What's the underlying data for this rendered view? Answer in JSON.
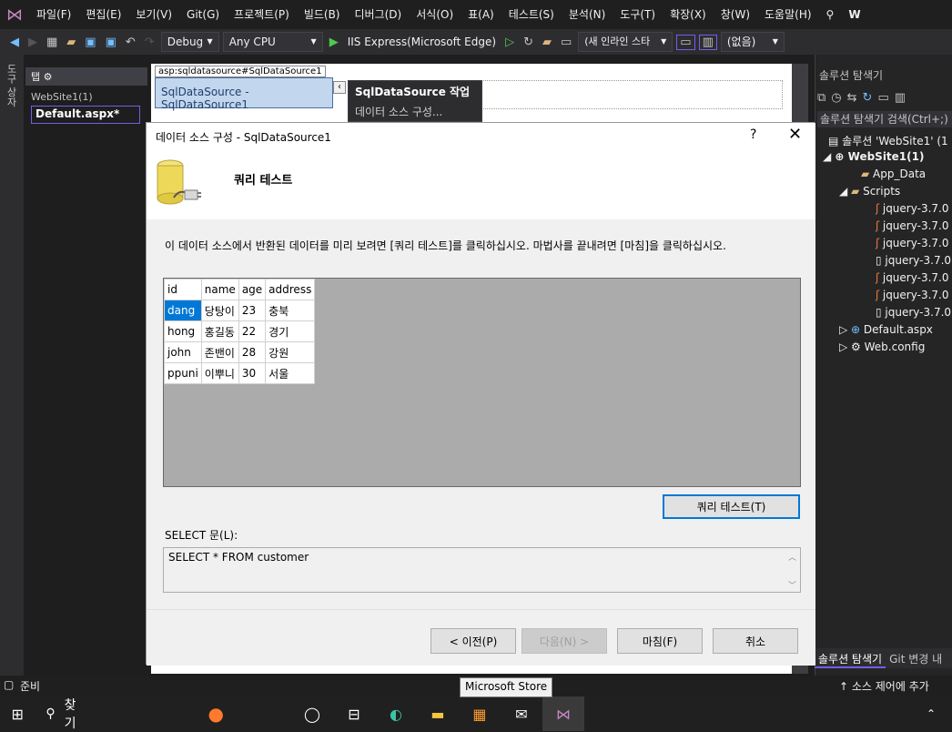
{
  "menubar": {
    "items": [
      "파일(F)",
      "편집(E)",
      "보기(V)",
      "Git(G)",
      "프로젝트(P)",
      "빌드(B)",
      "디버그(D)",
      "서식(O)",
      "표(A)",
      "테스트(S)",
      "분석(N)",
      "도구(T)",
      "확장(X)",
      "창(W)",
      "도움말(H)"
    ],
    "right_label": "W"
  },
  "toolbar": {
    "config": "Debug",
    "platform": "Any CPU",
    "run_target": "IIS Express(Microsoft Edge)",
    "inline_style": "(새 인라인 스타",
    "none_select": "(없음)"
  },
  "left_strip": {
    "toolbox": "도구 상자"
  },
  "doc": {
    "tab_header": "탭",
    "website_label": "WebSite1(1)",
    "default_file": "Default.aspx*"
  },
  "designer": {
    "asp_header": "asp:sqldatasource#SqlDataSource1",
    "control_name": "SqlDataSource",
    "control_id": "- SqlDataSource1",
    "task_title": "SqlDataSource 작업",
    "task_link": "데이터 소스 구성..."
  },
  "dialog": {
    "title": "데이터 소스 구성 - SqlDataSource1",
    "help": "?",
    "heading": "쿼리 테스트",
    "description": "이 데이터 소스에서 반환된 데이터를 미리 보려면 [쿼리 테스트]를 클릭하십시오. 마법사를 끝내려면 [마침]을 클릭하십시오.",
    "columns": [
      "id",
      "name",
      "age",
      "address"
    ],
    "rows": [
      [
        "dang",
        "당탕이",
        "23",
        "충북"
      ],
      [
        "hong",
        "홍길동",
        "22",
        "경기"
      ],
      [
        "john",
        "존밴이",
        "28",
        "강원"
      ],
      [
        "ppuni",
        "이뿌니",
        "30",
        "서울"
      ]
    ],
    "test_query_button": "쿼리 테스트(T)",
    "select_label": "SELECT 문(L):",
    "select_statement": "SELECT * FROM customer",
    "prev_button": "< 이전(P)",
    "next_button": "다음(N) >",
    "finish_button": "마침(F)",
    "cancel_button": "취소"
  },
  "solution_explorer": {
    "title": "솔루션 탐색기",
    "search": "솔루션 탐색기 검색(Ctrl+;)",
    "solution": "솔루션 'WebSite1' (1",
    "project": "WebSite1(1)",
    "nodes": [
      "App_Data",
      "Scripts",
      "jquery-3.7.0",
      "jquery-3.7.0",
      "jquery-3.7.0",
      "jquery-3.7.0",
      "jquery-3.7.0",
      "jquery-3.7.0",
      "jquery-3.7.0",
      "Default.aspx",
      "Web.config"
    ],
    "tab_active": "솔루션 탐색기",
    "tab_other": "Git 변경 내"
  },
  "status": {
    "left": "준비",
    "right": "소스 제어에 추가"
  },
  "taskbar": {
    "search": "찾기",
    "tooltip": "Microsoft Store"
  }
}
